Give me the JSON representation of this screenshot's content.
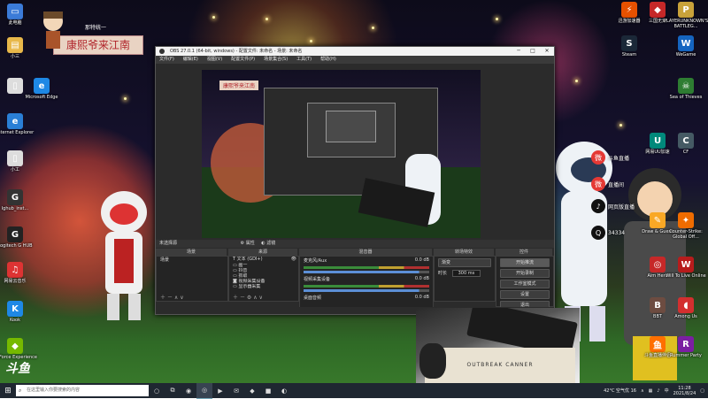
{
  "desktop": {
    "banner": "康熙爷来江南",
    "banner_small": "那特统一",
    "logo": "斗鱼",
    "left_icons": [
      {
        "label": "此电脑",
        "icon": "computer-icon",
        "color": "#3b7bd8",
        "glyph": "▭"
      },
      {
        "label": "小三",
        "icon": "folder-icon",
        "color": "#e8b84a",
        "glyph": "▤"
      },
      {
        "label": "",
        "icon": "file-icon",
        "color": "#ddd",
        "glyph": "▯"
      },
      {
        "label": "Microsoft Edge",
        "icon": "edge-icon",
        "color": "#1e88e5",
        "glyph": "e"
      },
      {
        "label": "Internet Explorer",
        "icon": "ie-icon",
        "color": "#2a7fd6",
        "glyph": "e"
      },
      {
        "label": "小工",
        "icon": "file-icon",
        "color": "#ddd",
        "glyph": "▯"
      },
      {
        "label": "lghub_inst...",
        "icon": "logitech-icon",
        "color": "#333",
        "glyph": "G"
      },
      {
        "label": "Logitech G HUB",
        "icon": "ghub-icon",
        "color": "#222",
        "glyph": "G"
      },
      {
        "label": "网易云音乐",
        "icon": "netease-music-icon",
        "color": "#d33",
        "glyph": "♫"
      },
      {
        "label": "Kook",
        "icon": "kook-icon",
        "color": "#1e88e5",
        "glyph": "K"
      },
      {
        "label": "GeForce Experience",
        "icon": "geforce-icon",
        "color": "#76b900",
        "glyph": "◆"
      }
    ],
    "right_icons": [
      {
        "label": "迅游加速器",
        "icon": "accelerator-icon",
        "color": "#e65100",
        "glyph": "⚡"
      },
      {
        "label": "三国无双",
        "icon": "game-icon",
        "color": "#c62828",
        "glyph": "◆"
      },
      {
        "label": "PLAYERUNKNOWN'S BATTLEG...",
        "icon": "pubg-icon",
        "color": "#c9a23a",
        "glyph": "P"
      },
      {
        "label": "Steam",
        "icon": "steam-icon",
        "color": "#1b2838",
        "glyph": "S"
      },
      {
        "label": "WeGame",
        "icon": "wegame-icon",
        "color": "#1565c0",
        "glyph": "W"
      },
      {
        "label": "Sea of Thieves",
        "icon": "sea-of-thieves-icon",
        "color": "#2e7d32",
        "glyph": "☠"
      },
      {
        "label": "网易UU加速",
        "icon": "uu-icon",
        "color": "#00897b",
        "glyph": "U"
      },
      {
        "label": "CF",
        "icon": "cf-icon",
        "color": "#455a64",
        "glyph": "C"
      },
      {
        "label": "Draw & Guess",
        "icon": "draw-guess-icon",
        "color": "#f9a825",
        "glyph": "✎"
      },
      {
        "label": "Counter-Strike: Global Off...",
        "icon": "csgo-icon",
        "color": "#ef6c00",
        "glyph": "✦"
      },
      {
        "label": "Aim Hero",
        "icon": "aim-hero-icon",
        "color": "#c62828",
        "glyph": "◎"
      },
      {
        "label": "Will To Live Online",
        "icon": "will-to-live-icon",
        "color": "#b71c1c",
        "glyph": "W"
      },
      {
        "label": "BBT",
        "icon": "bbt-icon",
        "color": "#6d4c41",
        "glyph": "B"
      },
      {
        "label": "Among Us",
        "icon": "among-us-icon",
        "color": "#d32f2f",
        "glyph": "◖"
      },
      {
        "label": "斗鱼直播伴侣",
        "icon": "douyu-icon",
        "color": "#ff6f00",
        "glyph": "鱼"
      },
      {
        "label": "Rummer Party",
        "icon": "rummer-icon",
        "color": "#7b1fa2",
        "glyph": "R"
      }
    ],
    "overlay_socials": [
      {
        "text": "斗鱼直播",
        "icon": "weibo-icon",
        "color": "#e53935",
        "glyph": "微"
      },
      {
        "text": "直播间",
        "icon": "weibo-icon",
        "color": "#e53935",
        "glyph": "微"
      },
      {
        "text": "网页版直播",
        "icon": "tiktok-icon",
        "color": "#111",
        "glyph": "♪"
      },
      {
        "text": "34334",
        "icon": "qq-icon",
        "color": "#111",
        "glyph": "Q"
      }
    ]
  },
  "obs": {
    "title": "OBS 27.0.1 (64-bit, windows) - 配置文件: 未命名 - 场景: 未命名",
    "window_controls": [
      "─",
      "□",
      "✕"
    ],
    "menu": [
      "文件(F)",
      "编辑(E)",
      "视图(V)",
      "配置文件(P)",
      "场景集合(S)",
      "工具(T)",
      "帮助(H)"
    ],
    "preview_banner": "康熙爷来江南",
    "source_selector": "未选择源",
    "properties_btn": "属性",
    "filters_btn": "滤镜",
    "scenes": {
      "header": "场景",
      "items": [
        "场景"
      ]
    },
    "sources": {
      "header": "来源",
      "items": [
        "文本 (GDI+)",
        "画一",
        "抖音",
        "抓取",
        "视频采集设备",
        "显示器采集"
      ]
    },
    "mixer": {
      "header": "混音器",
      "channels": [
        {
          "name": "麦克风/Aux",
          "level": "0.0 dB"
        },
        {
          "name": "视频采集设备",
          "level": "0.0 dB"
        },
        {
          "name": "桌面音频",
          "level": "0.0 dB"
        }
      ]
    },
    "transitions": {
      "header": "转场特效",
      "type": "渐变",
      "duration_label": "时长",
      "duration": "300 ms"
    },
    "controls": {
      "header": "控件",
      "buttons": [
        "开始推流",
        "开始录制",
        "工作室模式",
        "设置",
        "退出"
      ]
    },
    "status": "LIVE: 00:00:00  REC: 00:00:00  CPU: 12.2%, 60.00 fps"
  },
  "webcam": {
    "mat_text": "OUTBREAK CANNER"
  },
  "taskbar": {
    "search_placeholder": "在这里输入你要搜索的内容",
    "apps": [
      "○",
      "⧉",
      "◉",
      "◎",
      "▶",
      "✉",
      "◆",
      "■",
      "◐"
    ],
    "weather": "42°C 空气优 16",
    "ime": "中",
    "time": "11:28",
    "date": "2021/8/24"
  }
}
